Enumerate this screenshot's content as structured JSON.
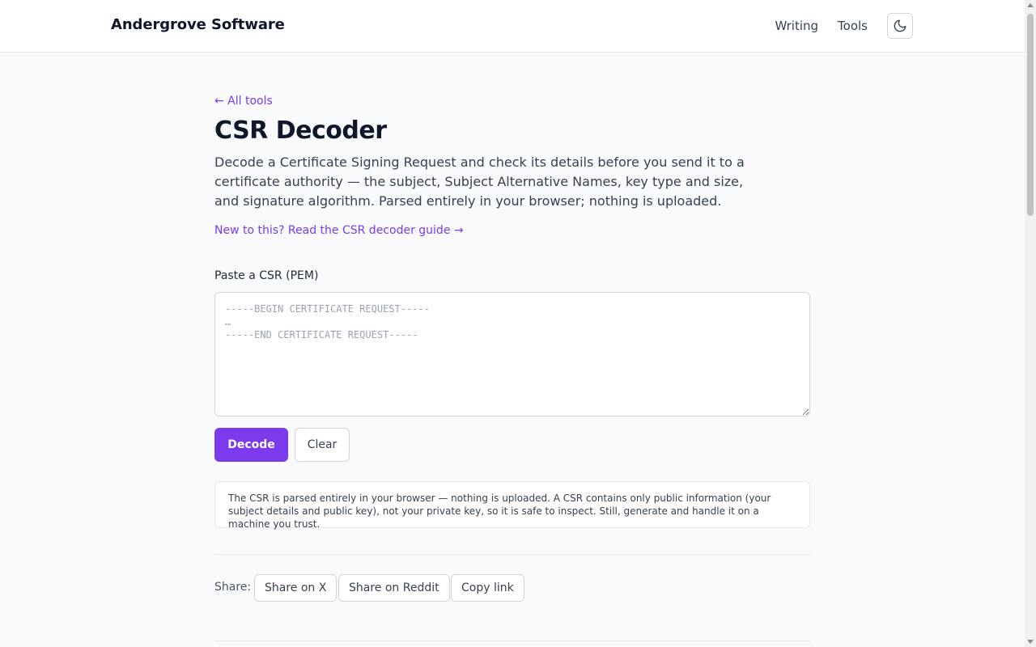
{
  "header": {
    "brand": "Andergrove Software",
    "nav": [
      "Writing",
      "Tools"
    ],
    "theme_icon": "moon-icon"
  },
  "page": {
    "back_link": "← All tools",
    "title": "CSR Decoder",
    "intro": "Decode a Certificate Signing Request and check its details before you send it to a certificate authority — the subject, Subject Alternative Names, key type and size, and signature algorithm. Parsed entirely in your browser; nothing is uploaded.",
    "guide_link": "New to this? Read the CSR decoder guide →"
  },
  "form": {
    "label": "Paste a CSR (PEM)",
    "placeholder": "-----BEGIN CERTIFICATE REQUEST-----\n…\n-----END CERTIFICATE REQUEST-----",
    "value": "",
    "decode_label": "Decode",
    "clear_label": "Clear"
  },
  "notice": "The CSR is parsed entirely in your browser — nothing is uploaded. A CSR contains only public information (your subject details and public key), not your private key, so it is safe to inspect. Still, generate and handle it on a machine you trust.",
  "share": {
    "label": "Share:",
    "buttons": [
      "Share on X",
      "Share on Reddit",
      "Copy link"
    ]
  },
  "colors": {
    "accent": "#7c3aed",
    "background": "#f8fafc",
    "text": "#0f172a"
  }
}
